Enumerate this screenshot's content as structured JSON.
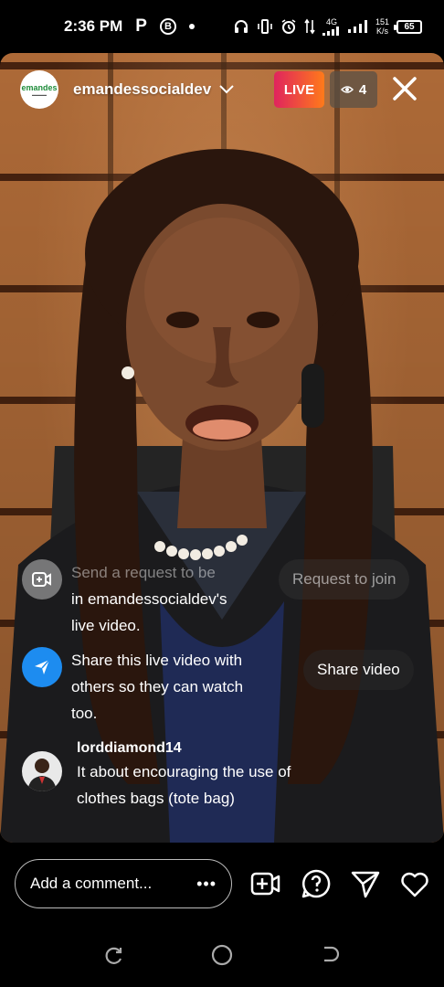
{
  "status_bar": {
    "time": "2:36 PM",
    "app_icon_p": "P",
    "app_icon_b": "B",
    "network_type": "4G",
    "speed_value": "151",
    "speed_unit": "K/s",
    "battery": "65"
  },
  "live": {
    "host_name": "emandessocialdev",
    "host_logo_text": "emandes",
    "live_label": "LIVE",
    "viewer_count": "4"
  },
  "feed": {
    "request": {
      "text_line1": "Send a request to be",
      "text_line2": "in emandessocialdev's",
      "text_line3": "live video.",
      "button": "Request to join"
    },
    "share": {
      "text_line1": "Share this live video with",
      "text_line2": "others so they can watch",
      "text_line3": "too.",
      "button": "Share video"
    },
    "comment": {
      "username": "lorddiamond14",
      "text_line1": "It about encouraging the use of",
      "text_line2": "clothes bags (tote bag)"
    }
  },
  "bottom_bar": {
    "comment_placeholder": "Add a comment...",
    "more_label": "•••"
  },
  "colors": {
    "live_gradient_start": "#e0245e",
    "live_gradient_end": "#ff7a1a",
    "share_icon_bg": "#1d8cf0",
    "brick": "#b66f3a"
  },
  "icons": [
    "headphones-icon",
    "vibrate-icon",
    "alarm-icon",
    "data-arrows-icon",
    "signal-icon",
    "battery-icon",
    "chevron-down-icon",
    "eye-icon",
    "close-icon",
    "add-video-icon",
    "send-icon",
    "question-icon",
    "heart-icon",
    "recent-apps-icon",
    "home-icon",
    "back-icon"
  ]
}
